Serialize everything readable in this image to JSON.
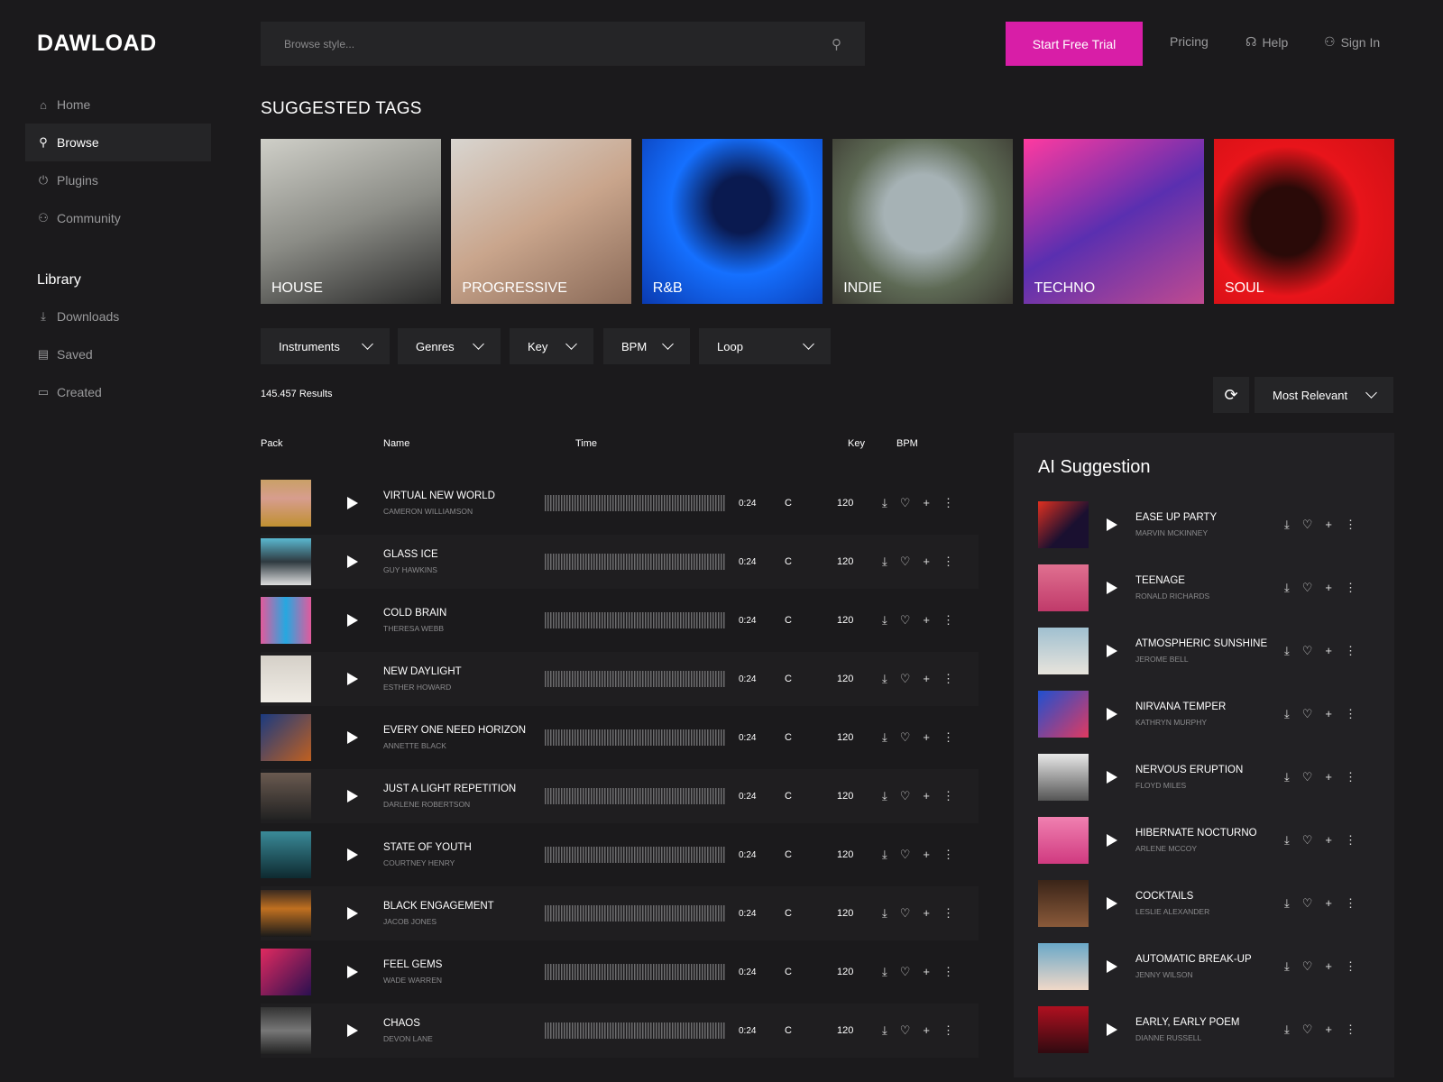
{
  "brand": "DAWLOAD",
  "nav": [
    {
      "label": "Home",
      "icon": "⌂"
    },
    {
      "label": "Browse",
      "icon": "⚲"
    },
    {
      "label": "Plugins",
      "icon": "⏻"
    },
    {
      "label": "Community",
      "icon": "⚇"
    }
  ],
  "library": {
    "title": "Library",
    "items": [
      {
        "label": "Downloads",
        "icon": "⤓"
      },
      {
        "label": "Saved",
        "icon": "▤"
      },
      {
        "label": "Created",
        "icon": "▭"
      }
    ]
  },
  "search": {
    "placeholder": "Browse style..."
  },
  "header": {
    "trial": "Start Free Trial",
    "pricing": "Pricing",
    "help": "Help",
    "signin": "Sign In"
  },
  "suggested": {
    "title": "SUGGESTED TAGS",
    "tags": [
      {
        "label": "HOUSE",
        "bg": "linear-gradient(160deg,#cfcfc8,#8b8c86 50%,#2a2a2a)"
      },
      {
        "label": "PROGRESSIVE",
        "bg": "linear-gradient(150deg,#d8d5d0,#c9a58c 50%,#8a6a58)"
      },
      {
        "label": "R&B",
        "bg": "radial-gradient(circle at 55% 40%,#0a1a50 20%,#1570ff 50%,#0a3ab0)"
      },
      {
        "label": "INDIE",
        "bg": "radial-gradient(circle at 50% 45%,#a6b2b5 30%,#5e6a55 60%,#3b3a32)"
      },
      {
        "label": "TECHNO",
        "bg": "linear-gradient(150deg,#ff3aa0,#5a2fb0 50%,#c04a90)"
      },
      {
        "label": "SOUL",
        "bg": "radial-gradient(circle at 40% 50%,#2a0a08 25%,#e8141a 55%,#d01015)"
      }
    ]
  },
  "filters": [
    "Instruments",
    "Genres",
    "Key",
    "BPM",
    "Loop"
  ],
  "results": "145.457 Results",
  "sort": "Most Relevant",
  "table": {
    "headers": {
      "pack": "Pack",
      "name": "Name",
      "time": "Time",
      "key": "Key",
      "bpm": "BPM"
    },
    "rows": [
      {
        "title": "VIRTUAL NEW WORLD",
        "artist": "CAMERON WILLIAMSON",
        "time": "0:24",
        "key": "C",
        "bpm": "120",
        "bg": "linear-gradient(#c9a067,#d79d8e 40%,#c09030)"
      },
      {
        "title": "GLASS ICE",
        "artist": "GUY HAWKINS",
        "time": "0:24",
        "key": "C",
        "bpm": "120",
        "bg": "linear-gradient(#5ab8d0,#2f3a40 50%,#ddd)"
      },
      {
        "title": "COLD BRAIN",
        "artist": "THERESA WEBB",
        "time": "0:24",
        "key": "C",
        "bpm": "120",
        "bg": "linear-gradient(90deg,#e25a9c,#26a8e0 50%,#e25a9c)"
      },
      {
        "title": "NEW DAYLIGHT",
        "artist": "ESTHER HOWARD",
        "time": "0:24",
        "key": "C",
        "bpm": "120",
        "bg": "linear-gradient(#d5d0c8,#f0ece5)"
      },
      {
        "title": "EVERY ONE NEED HORIZON",
        "artist": "ANNETTE BLACK",
        "time": "0:24",
        "key": "C",
        "bpm": "120",
        "bg": "linear-gradient(135deg,#1a3a80,#c06020)"
      },
      {
        "title": "JUST A LIGHT REPETITION",
        "artist": "DARLENE ROBERTSON",
        "time": "0:24",
        "key": "C",
        "bpm": "120",
        "bg": "linear-gradient(#6a5a50,#222)"
      },
      {
        "title": "STATE OF YOUTH",
        "artist": "COURTNEY HENRY",
        "time": "0:24",
        "key": "C",
        "bpm": "120",
        "bg": "linear-gradient(#3a8a98,#0e2a30)"
      },
      {
        "title": "BLACK ENGAGEMENT",
        "artist": "JACOB JONES",
        "time": "0:24",
        "key": "C",
        "bpm": "120",
        "bg": "linear-gradient(#3a2a20,#c07020 40%,#1a1a1a)"
      },
      {
        "title": "FEEL GEMS",
        "artist": "WADE WARREN",
        "time": "0:24",
        "key": "C",
        "bpm": "120",
        "bg": "linear-gradient(135deg,#e02a60,#2a1050)"
      },
      {
        "title": "CHAOS",
        "artist": "DEVON LANE",
        "time": "0:24",
        "key": "C",
        "bpm": "120",
        "bg": "linear-gradient(#333,#777 50%,#222)"
      }
    ]
  },
  "ai": {
    "title": "AI Suggestion",
    "items": [
      {
        "title": "EASE UP PARTY",
        "artist": "MARVIN MCKINNEY",
        "bg": "linear-gradient(135deg,#e03020,#1a1030 60%)"
      },
      {
        "title": "TEENAGE",
        "artist": "RONALD RICHARDS",
        "bg": "linear-gradient(#e07090,#c03a6a)"
      },
      {
        "title": "ATMOSPHERIC SUNSHINE",
        "artist": "JEROME BELL",
        "bg": "linear-gradient(#a0c0d0,#e8e4dc)"
      },
      {
        "title": "NIRVANA TEMPER",
        "artist": "KATHRYN MURPHY",
        "bg": "linear-gradient(135deg,#2050d0,#e03a60)"
      },
      {
        "title": "NERVOUS ERUPTION",
        "artist": "FLOYD MILES",
        "bg": "linear-gradient(#e8e8e8,#555)"
      },
      {
        "title": "HIBERNATE NOCTURNO",
        "artist": "ARLENE MCCOY",
        "bg": "linear-gradient(#f080b0,#d03a80)"
      },
      {
        "title": "COCKTAILS",
        "artist": "LESLIE ALEXANDER",
        "bg": "linear-gradient(#3a2418,#8a5a3a)"
      },
      {
        "title": "AUTOMATIC BREAK-UP",
        "artist": "JENNY WILSON",
        "bg": "linear-gradient(#6aa8c8,#f0d8c8)"
      },
      {
        "title": "EARLY, EARLY POEM",
        "artist": "DIANNE RUSSELL",
        "bg": "linear-gradient(#b01020,#300a10)"
      }
    ]
  }
}
